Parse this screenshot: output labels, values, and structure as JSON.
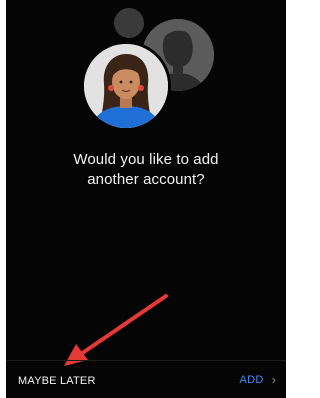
{
  "prompt": {
    "line1": "Would you like to add",
    "line2": "another account?"
  },
  "actions": {
    "maybe_later": "MAYBE LATER",
    "add": "ADD",
    "add_chevron": "›"
  },
  "icons": {
    "primary_avatar": "woman-avatar-icon",
    "secondary_avatar": "person-silhouette-icon",
    "chevron": "chevron-right-icon",
    "annotation": "red-arrow-annotation"
  },
  "colors": {
    "background": "#050505",
    "text": "#f2f2f2",
    "add_accent": "#3d8df5",
    "annotation": "#e53935",
    "avatar_shirt": "#1f6fd6"
  }
}
